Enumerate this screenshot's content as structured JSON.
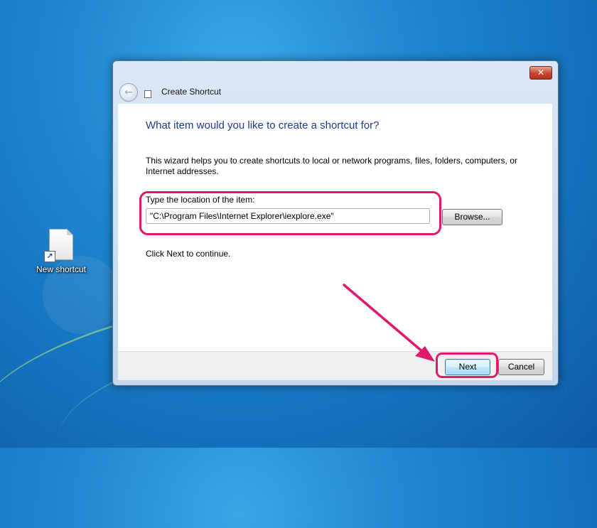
{
  "desktop": {
    "icons": [
      {
        "label": "New shortcut",
        "icon": "document-shortcut-icon"
      }
    ]
  },
  "window": {
    "title": "Create Shortcut",
    "close_label": "✕",
    "back_icon": "back-arrow-icon",
    "heading": "What item would you like to create a shortcut for?",
    "description": "This wizard helps you to create shortcuts to local or network programs, files, folders, computers, or Internet addresses.",
    "location_label": "Type the location of the item:",
    "location_value": "\"C:\\Program Files\\Internet Explorer\\iexplore.exe\"",
    "browse_label": "Browse...",
    "continue_text": "Click Next to continue.",
    "next_label": "Next",
    "cancel_label": "Cancel"
  },
  "annotations": {
    "highlight_color": "#e0196f"
  },
  "colors": {
    "heading": "#1e3d8f",
    "desktop": "#1f86cf"
  }
}
